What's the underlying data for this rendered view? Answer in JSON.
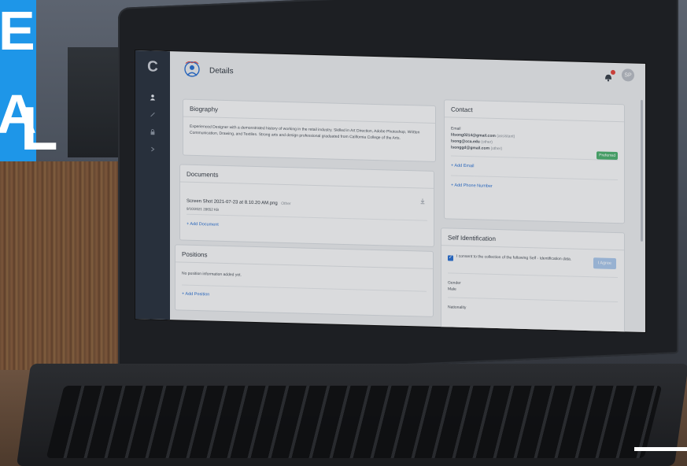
{
  "banner": {
    "letters": [
      "E",
      "A",
      "L"
    ]
  },
  "app": {
    "logo": "C",
    "page_title": "Details",
    "user_initials": "SP"
  },
  "biography": {
    "title": "Biography",
    "text": "Experienced Designer with a demonstrated history of working in the retail industry. Skilled in Art Direction, Adobe Photoshop, Written Communication, Drawing, and Textiles. Strong arts and design professional graduated from California College of the Arts."
  },
  "documents": {
    "title": "Documents",
    "file_name": "Screen Shot 2021-07-23 at 8.10.20 AM.png",
    "file_type": "Other",
    "file_meta": "9/10/2021 28652 KB",
    "add_label": "+ Add Document"
  },
  "positions": {
    "title": "Positions",
    "empty_text": "No position information added yet.",
    "add_label": "+ Add Position"
  },
  "contact": {
    "title": "Contact",
    "email_label": "Email",
    "emails": [
      {
        "address": "lilsong0214@gmail.com",
        "type": "(assistant)"
      },
      {
        "address": "lsong@cca.edu",
        "type": "(other)"
      },
      {
        "address": "lsonggd@gmail.com",
        "type": "(other)"
      }
    ],
    "preferred_label": "Preferred",
    "add_email": "+ Add Email",
    "add_phone": "+ Add Phone Number"
  },
  "self_identification": {
    "title": "Self Identification",
    "consent_text": "I consent to the collection of the following Self - Identification data.",
    "agree_label": "I Agree",
    "gender_label": "Gender",
    "gender_value": "Male",
    "nationality_label": "Nationality"
  },
  "colors": {
    "brand_blue": "#1e96e8",
    "sidebar": "#2a3340",
    "link": "#2a6fd0",
    "preferred_badge": "#4caf70"
  },
  "icons": [
    "user-icon",
    "pencil-icon",
    "lock-icon",
    "chevron-right-icon",
    "bell-icon",
    "download-icon",
    "checkbox-icon"
  ]
}
